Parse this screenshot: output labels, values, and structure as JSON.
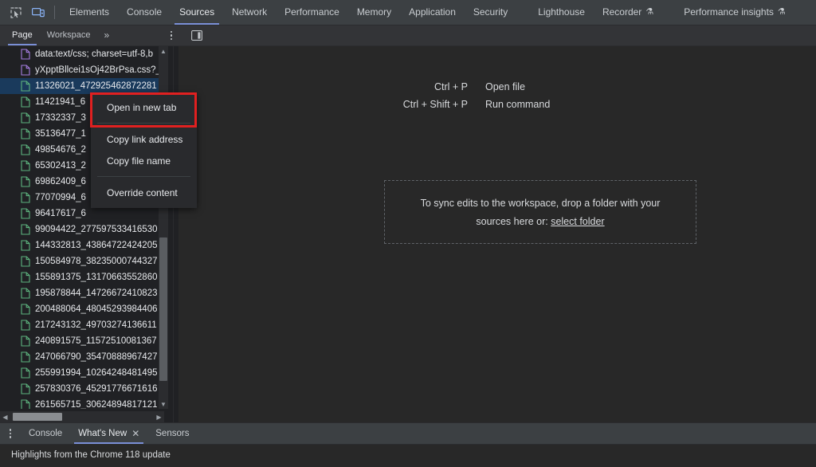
{
  "theme": {
    "toolbar_bg": "#3c4043",
    "panel_bg": "#202124",
    "editor_bg": "#282828",
    "accent": "#7a8fd6",
    "selection_bg": "#1a3a5c",
    "highlight_red": "#e02020",
    "css_icon": "#a57ddf",
    "doc_icon": "#5db37e"
  },
  "main_toolbar": {
    "icons": [
      {
        "name": "inspect-element-icon",
        "label": "Inspect element"
      },
      {
        "name": "device-toolbar-icon",
        "label": "Toggle device toolbar"
      }
    ],
    "tabs": [
      {
        "label": "Elements",
        "active": false,
        "beaker": false
      },
      {
        "label": "Console",
        "active": false,
        "beaker": false
      },
      {
        "label": "Sources",
        "active": true,
        "beaker": false
      },
      {
        "label": "Network",
        "active": false,
        "beaker": false
      },
      {
        "label": "Performance",
        "active": false,
        "beaker": false
      },
      {
        "label": "Memory",
        "active": false,
        "beaker": false
      },
      {
        "label": "Application",
        "active": false,
        "beaker": false
      },
      {
        "label": "Security",
        "active": false,
        "beaker": false
      },
      {
        "label": "Lighthouse",
        "active": false,
        "beaker": false
      },
      {
        "label": "Recorder",
        "active": false,
        "beaker": true
      },
      {
        "label": "Performance insights",
        "active": false,
        "beaker": true
      }
    ],
    "beaker_glyph": "⚗"
  },
  "sub_toolbar": {
    "tabs": [
      {
        "label": "Page",
        "active": true
      },
      {
        "label": "Workspace",
        "active": false
      }
    ],
    "more_label": "»",
    "icons": [
      {
        "name": "more-options-icon",
        "label": "More options"
      },
      {
        "name": "show-navigator-icon",
        "label": "Toggle navigator panel"
      }
    ]
  },
  "navigator": {
    "files": [
      {
        "name": "data:text/css; charset=utf-8,b",
        "type": "css",
        "selected": false
      },
      {
        "name": "yXpptBllcei1sOj42BrPsa.css?_",
        "type": "css",
        "selected": false
      },
      {
        "name": "11326021_472925462872281",
        "type": "doc",
        "selected": true
      },
      {
        "name": "11421941_6",
        "type": "doc",
        "selected": false
      },
      {
        "name": "17332337_3",
        "type": "doc",
        "selected": false
      },
      {
        "name": "35136477_1",
        "type": "doc",
        "selected": false
      },
      {
        "name": "49854676_2",
        "type": "doc",
        "selected": false
      },
      {
        "name": "65302413_2",
        "type": "doc",
        "selected": false
      },
      {
        "name": "69862409_6",
        "type": "doc",
        "selected": false
      },
      {
        "name": "77070994_6",
        "type": "doc",
        "selected": false
      },
      {
        "name": "96417617_6",
        "type": "doc",
        "selected": false
      },
      {
        "name": "99094422_277597533416530",
        "type": "doc",
        "selected": false
      },
      {
        "name": "144332813_43864722424205",
        "type": "doc",
        "selected": false
      },
      {
        "name": "150584978_38235000744327",
        "type": "doc",
        "selected": false
      },
      {
        "name": "155891375_13170663552860",
        "type": "doc",
        "selected": false
      },
      {
        "name": "195878844_14726672410823",
        "type": "doc",
        "selected": false
      },
      {
        "name": "200488064_48045293984406",
        "type": "doc",
        "selected": false
      },
      {
        "name": "217243132_49703274136611",
        "type": "doc",
        "selected": false
      },
      {
        "name": "240891575_11572510081367",
        "type": "doc",
        "selected": false
      },
      {
        "name": "247066790_35470888967427",
        "type": "doc",
        "selected": false
      },
      {
        "name": "255991994_10264248481495",
        "type": "doc",
        "selected": false
      },
      {
        "name": "257830376_45291776671616",
        "type": "doc",
        "selected": false
      },
      {
        "name": "261565715_30624894817121",
        "type": "doc",
        "selected": false
      }
    ],
    "vscrollbar": {
      "up_glyph": "▲",
      "down_glyph": "▼"
    },
    "hscrollbar": {
      "left_glyph": "◀",
      "right_glyph": "▶"
    }
  },
  "context_menu": {
    "items": [
      {
        "label": "Open in new tab",
        "highlighted": true,
        "separator_after": true
      },
      {
        "label": "Copy link address",
        "highlighted": false,
        "separator_after": false
      },
      {
        "label": "Copy file name",
        "highlighted": false,
        "separator_after": true
      },
      {
        "label": "Override content",
        "highlighted": false,
        "separator_after": false
      }
    ]
  },
  "editor": {
    "shortcuts": [
      {
        "keys": "Ctrl + P",
        "desc": "Open file"
      },
      {
        "keys": "Ctrl + Shift + P",
        "desc": "Run command"
      }
    ],
    "dropzone": {
      "line1": "To sync edits to the workspace, drop a folder with your",
      "line2_prefix": "sources here or:",
      "link_label": "select folder"
    }
  },
  "drawer": {
    "menu_icon": "more-options-icon",
    "tabs": [
      {
        "label": "Console",
        "active": false,
        "closable": false
      },
      {
        "label": "What's New",
        "active": true,
        "closable": true
      },
      {
        "label": "Sensors",
        "active": false,
        "closable": false
      }
    ],
    "close_glyph": "✕",
    "whats_new_title": "Highlights from the Chrome 118 update"
  }
}
